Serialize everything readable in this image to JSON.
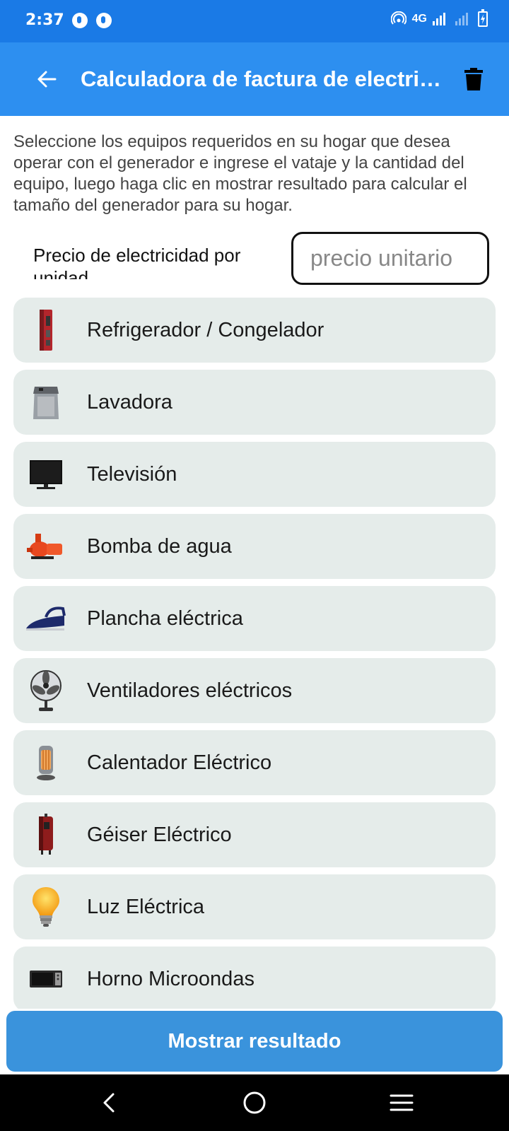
{
  "status_bar": {
    "time": "2:37",
    "network": "4G"
  },
  "app_bar": {
    "title": "Calculadora de factura de electricidad"
  },
  "instructions": "Seleccione los equipos requeridos en su hogar que desea operar con el generador e ingrese el vataje y la cantidad del equipo, luego haga clic en mostrar resultado para calcular el tamaño del generador para su hogar.",
  "price": {
    "label": "Precio de electricidad por unidad",
    "placeholder": "precio unitario",
    "value": ""
  },
  "appliances": [
    {
      "label": "Refrigerador / Congelador",
      "icon": "refrigerator-icon"
    },
    {
      "label": "Lavadora",
      "icon": "washing-machine-icon"
    },
    {
      "label": "Televisión",
      "icon": "television-icon"
    },
    {
      "label": "Bomba de agua",
      "icon": "water-pump-icon"
    },
    {
      "label": "Plancha eléctrica",
      "icon": "iron-icon"
    },
    {
      "label": "Ventiladores eléctricos",
      "icon": "fan-icon"
    },
    {
      "label": "Calentador Eléctrico",
      "icon": "heater-icon"
    },
    {
      "label": "Géiser Eléctrico",
      "icon": "geyser-icon"
    },
    {
      "label": "Luz Eléctrica",
      "icon": "light-bulb-icon"
    },
    {
      "label": "Horno Microondas",
      "icon": "microwave-icon"
    }
  ],
  "show_result_label": "Mostrar resultado",
  "colors": {
    "status_bar": "#1a7ae6",
    "app_bar": "#2d8ff0",
    "item_background": "#e5ecea",
    "button": "#3a93dc"
  }
}
